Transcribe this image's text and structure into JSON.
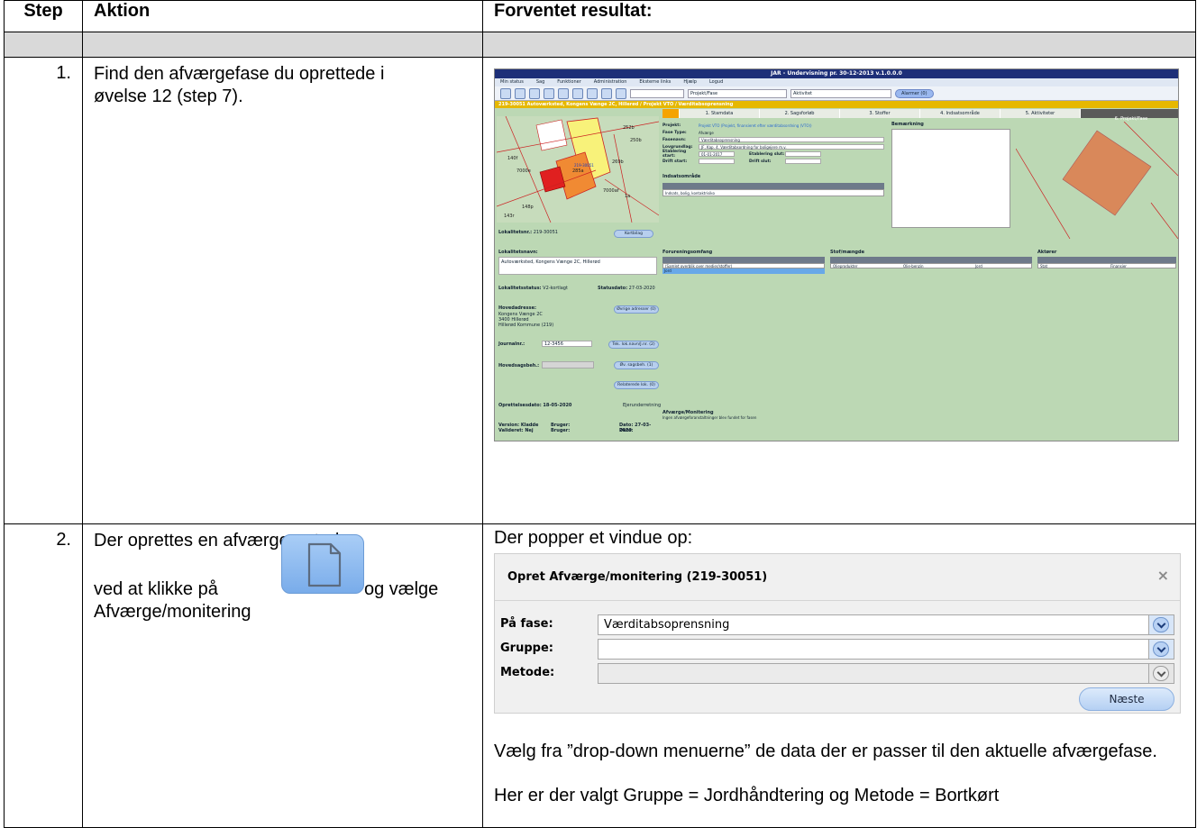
{
  "table": {
    "headers": {
      "step": "Step",
      "aktion": "Aktion",
      "resultat": "Forventet resultat:"
    },
    "rows": [
      {
        "step": "1.",
        "aktion": "Find den afværgefase du oprettede i øvelse 12 (step 7).",
        "result_text": ""
      },
      {
        "step": "2.",
        "aktion_part1": "Der oprettes en afværgemetode",
        "aktion_part2": "ved at klikke på",
        "aktion_part3": "og vælge",
        "aktion_part4": "Afværge/monitering",
        "result_intro": "Der popper et vindue op:",
        "result_p1": "Vælg fra ”drop-down menuerne” de data der er passer til den aktuelle afværgefase.",
        "result_p2": "Her er der valgt Gruppe = Jordhåndtering og Metode = Bortkørt"
      }
    ]
  },
  "icon_button": {
    "icon": "new-document-icon"
  },
  "dialog": {
    "title": "Opret Afværge/monitering (219-30051)",
    "close_glyph": "×",
    "fields": [
      {
        "label": "På fase:",
        "value": "Værditabsoprensning",
        "disabled": false
      },
      {
        "label": "Gruppe:",
        "value": "",
        "disabled": false
      },
      {
        "label": "Metode:",
        "value": "",
        "disabled": true
      }
    ],
    "next_label": "Næste"
  },
  "app": {
    "window_title": "JAR - Undervisning pr. 30-12-2013 v.1.0.0.0",
    "menu": [
      "Min status",
      "Sag",
      "Funktioner",
      "Administration",
      "Eksterne links",
      "Hjælp",
      "Logud"
    ],
    "toolbar_select1": "Projekt/Fase",
    "toolbar_select2": "Aktivitet",
    "alarms": "Alarmer (0)",
    "case_bar": "219-30051 Autoværksted, Kongens Vænge 2C, Hillerød / Projekt VTO / Værditabsoprensning",
    "tabs": [
      "1. Stamdata",
      "2. Sagsforløb",
      "3. Stoffer",
      "4. Indsatsområde",
      "5. Aktiviteter",
      "6. Projekt/Fase"
    ],
    "map_labels": [
      "252b",
      "250b",
      "140f",
      "7000e",
      "269b",
      "219-30051",
      "285a",
      "7000af",
      "1a",
      "148p",
      "143r"
    ],
    "lokalitetsnr_label": "Lokalitetsnr.:",
    "lokalitetsnr": "219-30051",
    "kortbilag": "Kortbilag",
    "lokalitetsnavn_label": "Lokalitetsnavn:",
    "lokalitetsnavn": "Autoværksted, Kongens Vænge 2C, Hillerød",
    "status_label": "Lokalitetsstatus:",
    "status": "V2-kortlagt",
    "statusdato_label": "Statusdato:",
    "statusdato": "27-03-2020",
    "hovedadresse_label": "Hovedadresse:",
    "adresse": [
      "Kongens Vænge 2C",
      "3400 Hillerød",
      "Hillerød Kommune (219)"
    ],
    "ovrige_adresser": "Øvrige adresser (0)",
    "journalnr_label": "Journalnr.:",
    "journalnr": "12-3456",
    "tek_lok": "Tek. lok.navn/J.nr. (2)",
    "hovedsagsbeh_label": "Hovedsagsbeh.:",
    "ov_sagsbeh": "Øv. sagsbeh. (1)",
    "relaterede": "Relaterede lok. (0)",
    "oprettelsesdato": "Oprettelsesdato: 18-05-2020",
    "ejerunderretning": "Ejerunderretning",
    "version": "Version: Kladde",
    "valideret": "Valideret: Nej",
    "bruger1": "Bruger:",
    "bruger2": "Bruger:",
    "dato1": "Dato: 27-03-2020",
    "dato2": "Dato:",
    "fields": [
      {
        "k": "Projekt:",
        "v": "Projekt VTO (Projekt, finansieret efter værditabsordning (VTO))"
      },
      {
        "k": "Fase Type:",
        "v": "Afværge"
      },
      {
        "k": "Fasenavn:",
        "v": "Værditabsoprensning"
      },
      {
        "k": "Lovgrundlag:",
        "v": "JF, Kap. 4. Værditabsordning for boligejere m.v."
      },
      {
        "k": "Etablering start:",
        "v": "01-01-2017"
      },
      {
        "k": "Drift start:",
        "v": ""
      }
    ],
    "etablering_slut": "Etablering slut:",
    "drift_slut": "Drift slut:",
    "bemaerkning": "Bemærkning",
    "indsatsomraade_label": "Indsatsområde",
    "indsatsomraade_row": "Indsats, bolig, kontaktrisiko",
    "forureningsomfang": "Forureningsomfang",
    "stof_maengde": "Stof/mængde",
    "aktoerer": "Aktører",
    "col_headers_left": [
      "Medie",
      "Mængde",
      "Dybde",
      "Stoffer"
    ],
    "col_headers_mid": [
      "Stof",
      "Stofgruppe",
      "Medie",
      "Mængde"
    ],
    "col_headers_right": [
      "Aktør",
      "Rolle"
    ],
    "row_left1": "(Samlet overblik over medier/stoffer)",
    "row_left2": "Jord",
    "row_mid": [
      "Olieprodukter",
      "Olie-benzin",
      "Jord"
    ],
    "row_right": [
      "Stat",
      "Finansier"
    ],
    "afvaerge_label": "Afværge/Monitering",
    "afvaerge_text": "Ingen afværgeforanstaltninger blev fundet for fasen"
  }
}
